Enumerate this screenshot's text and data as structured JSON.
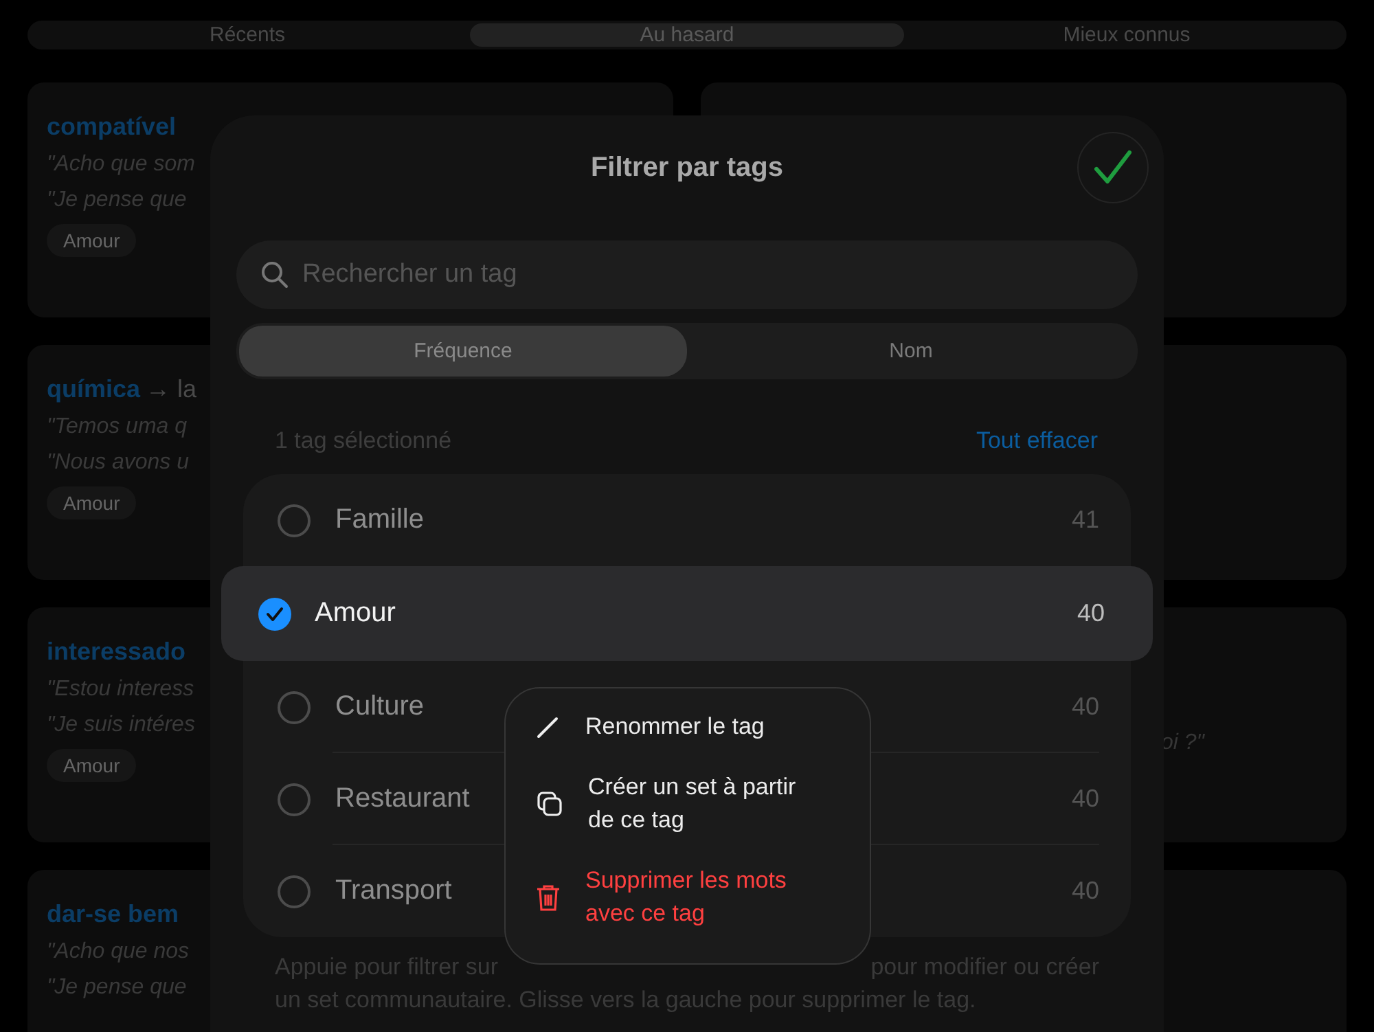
{
  "tabs": [
    {
      "label": "Récents",
      "selected": false
    },
    {
      "label": "Au hasard",
      "selected": true
    },
    {
      "label": "Mieux connus",
      "selected": false
    }
  ],
  "left_cards": [
    {
      "headword": "compatível",
      "lines": [
        "\"Acho que som",
        "\"Je pense que"
      ],
      "tag": "Amour"
    },
    {
      "headword": "química",
      "rest": "→ la",
      "lines": [
        "\"Temos uma q",
        "\"Nous avons u"
      ],
      "tag": "Amour"
    },
    {
      "headword": "interessado",
      "lines": [
        "\"Estou interess",
        "\"Je suis intéres"
      ],
      "tag": "Amour"
    },
    {
      "headword": "dar-se bem",
      "lines": [
        "\"Acho que nos",
        "\"Je pense que"
      ]
    }
  ],
  "right_cards": [
    {
      "kind": "blank"
    },
    {
      "kind": "blank"
    },
    {
      "kind": "text",
      "snippet": "oi ?\""
    },
    {
      "kind": "blank"
    }
  ],
  "sheet": {
    "title": "Filtrer par tags",
    "search": {
      "placeholder": "Rechercher un tag"
    },
    "sort_tabs": [
      {
        "label": "Fréquence",
        "selected": true
      },
      {
        "label": "Nom",
        "selected": false
      }
    ],
    "selection_count": "1 tag sélectionné",
    "clear_all": "Tout effacer",
    "tags": [
      {
        "name": "Famille",
        "count": "41",
        "selected": false
      },
      {
        "name": "Amour",
        "count": "40",
        "selected": true
      },
      {
        "name": "Culture",
        "count": "40",
        "selected": false
      },
      {
        "name": "Restaurant",
        "count": "40",
        "selected": false
      },
      {
        "name": "Transport",
        "count": "40",
        "selected": false
      }
    ],
    "context_menu": [
      {
        "kind": "edit",
        "label": "Renommer le tag"
      },
      {
        "kind": "duplicate",
        "label": "Créer un set à partir de ce tag"
      },
      {
        "kind": "delete",
        "label": "Supprimer les mots avec ce tag"
      }
    ],
    "footer": {
      "line_1_start": "Appuie pour filtrer sur",
      "line_1_end": "pour modifier ou créer",
      "line_2": "un set communautaire. Glisse vers la gauche pour supprimer le tag."
    }
  }
}
